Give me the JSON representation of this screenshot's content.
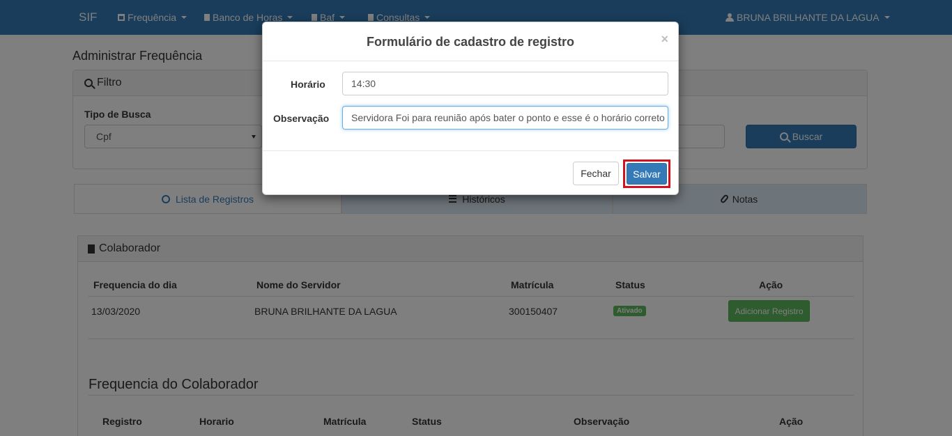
{
  "navbar": {
    "brand": "SIF",
    "menus": [
      {
        "label": "Frequência"
      },
      {
        "label": "Banco de Horas"
      },
      {
        "label": "Baf"
      },
      {
        "label": "Consultas"
      }
    ],
    "user": "BRUNA BRILHANTE DA LAGUA"
  },
  "page": {
    "title": "Administrar Frequência",
    "filter": {
      "title": "Filtro",
      "tipo_label": "Tipo de Busca",
      "tipo_value": "Cpf",
      "buscar_label": "Buscar"
    },
    "tabs": [
      "Lista de Registros",
      "Históricos",
      "Notas"
    ],
    "colaborador": {
      "title": "Colaborador",
      "headers": [
        "Frequencia do dia",
        "Nome do Servidor",
        "Matrícula",
        "Status",
        "Ação"
      ],
      "row": {
        "data": "13/03/2020",
        "nome": "BRUNA BRILHANTE DA LAGUA",
        "matricula": "300150407",
        "status": "Ativado",
        "acao": "Adicionar Registro"
      },
      "frequencia_title": "Frequencia do Colaborador",
      "freq_headers": [
        "Registro",
        "Horario",
        "Matrícula",
        "Status",
        "Observação",
        "Ação"
      ]
    }
  },
  "modal": {
    "title": "Formulário de cadastro de registro",
    "close": "×",
    "horario_label": "Horário",
    "horario_value": "14:30",
    "obs_label": "Observação",
    "obs_value": "Servidora Foi para reunião após bater o ponto e esse é o horário correto do",
    "fechar": "Fechar",
    "salvar": "Salvar"
  }
}
